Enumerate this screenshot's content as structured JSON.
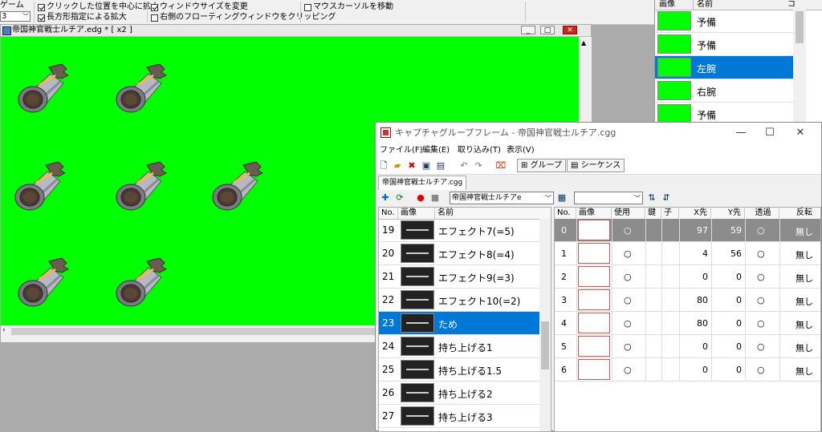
{
  "options": {
    "game_label": "ゲーム",
    "small_select": "3",
    "opt1": "クリックした位置を中心に拡大",
    "opt2": "長方形指定による拡大",
    "opt3": "ウィンドウサイズを変更",
    "opt4": "右側のフローティングウィンドウをクリッピング",
    "opt5": "マウスカーソルを移動"
  },
  "edg_window": {
    "title": "帝国神官戦士ルチア.edg * [ x2 ]"
  },
  "part_list": {
    "head_image": "画像",
    "head_name": "名前",
    "head_extra": "コ",
    "items": [
      {
        "name": "予備"
      },
      {
        "name": "予備"
      },
      {
        "name": "左腕"
      },
      {
        "name": "右腕"
      },
      {
        "name": "予備"
      }
    ]
  },
  "capture_window": {
    "title": "キャプチャグループフレーム - 帝国神官戦士ルチア.cgg",
    "menu": [
      "ファイル(F)",
      "編集(E)",
      "取り込み(T)",
      "表示(V)"
    ],
    "group_btn": "グループ",
    "sequence_btn": "シーケンス",
    "tab": "帝国神官戦士ルチア.cgg",
    "combo_value": "帝国神官戦士ルチアe",
    "left_headers": [
      "No.",
      "画像",
      "名前"
    ],
    "left_rows": [
      {
        "no": "19",
        "name": "エフェクト7(=5)"
      },
      {
        "no": "20",
        "name": "エフェクト8(=4)"
      },
      {
        "no": "21",
        "name": "エフェクト9(=3)"
      },
      {
        "no": "22",
        "name": "エフェクト10(=2)"
      },
      {
        "no": "23",
        "name": "ため"
      },
      {
        "no": "24",
        "name": "持ち上げる1"
      },
      {
        "no": "25",
        "name": "持ち上げる1.5"
      },
      {
        "no": "26",
        "name": "持ち上げる2"
      },
      {
        "no": "27",
        "name": "持ち上げる3"
      }
    ],
    "right_headers": [
      "No.",
      "画像",
      "使用",
      "鍵",
      "子",
      "X先",
      "Y先",
      "透過",
      "反転"
    ],
    "right_rows": [
      {
        "no": "0",
        "use": "○",
        "x": "97",
        "y": "59",
        "trans": "○",
        "flip": "無し"
      },
      {
        "no": "1",
        "use": "○",
        "x": "4",
        "y": "56",
        "trans": "○",
        "flip": "無し"
      },
      {
        "no": "2",
        "use": "○",
        "x": "0",
        "y": "0",
        "trans": "○",
        "flip": "無し"
      },
      {
        "no": "3",
        "use": "○",
        "x": "80",
        "y": "0",
        "trans": "○",
        "flip": "無し"
      },
      {
        "no": "4",
        "use": "○",
        "x": "80",
        "y": "0",
        "trans": "○",
        "flip": "無し"
      },
      {
        "no": "5",
        "use": "○",
        "x": "0",
        "y": "0",
        "trans": "○",
        "flip": "無し"
      },
      {
        "no": "6",
        "use": "○",
        "x": "0",
        "y": "0",
        "trans": "○",
        "flip": "無し"
      }
    ]
  },
  "colors": {
    "canvas": "#00ff00",
    "selection": "#0078d7"
  }
}
